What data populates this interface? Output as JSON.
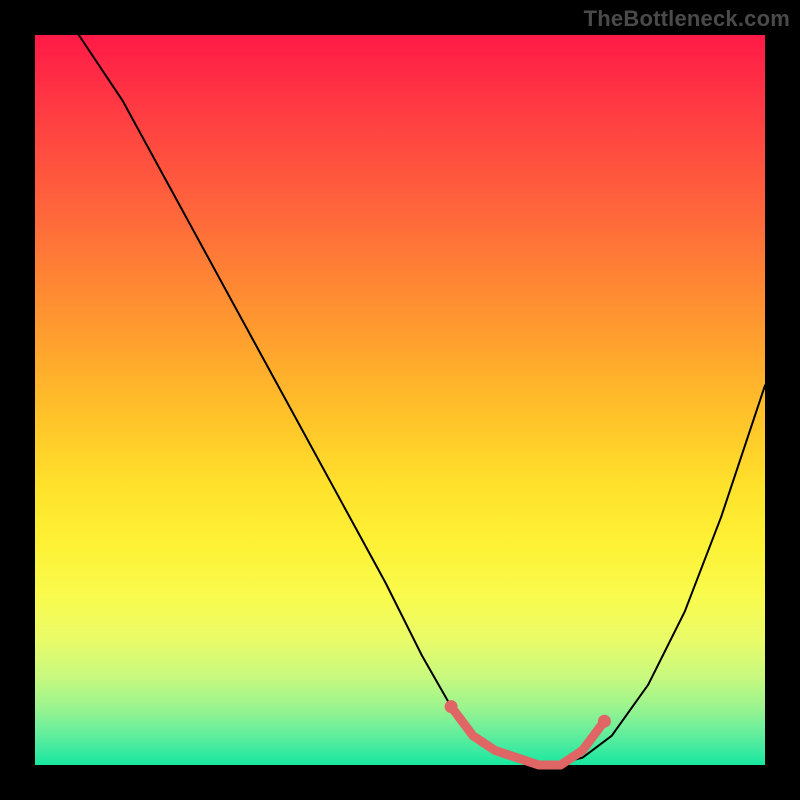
{
  "watermark": "TheBottleneck.com",
  "chart_data": {
    "type": "line",
    "title": "",
    "xlabel": "",
    "ylabel": "",
    "xlim": [
      0,
      100
    ],
    "ylim": [
      0,
      100
    ],
    "grid": false,
    "legend": false,
    "series": [
      {
        "name": "bottleneck-curve",
        "x": [
          0,
          6,
          12,
          18,
          24,
          30,
          36,
          42,
          48,
          53,
          57,
          61,
          65,
          68,
          71,
          75,
          79,
          84,
          89,
          94,
          100
        ],
        "values": [
          106,
          100,
          91,
          80,
          69,
          58,
          47,
          36,
          25,
          15,
          8,
          3,
          1,
          0,
          0,
          1,
          4,
          11,
          21,
          34,
          52
        ]
      }
    ],
    "highlight_range": {
      "name": "optimal-region",
      "x": [
        57,
        60,
        63,
        66,
        69,
        72,
        75,
        78
      ],
      "values": [
        8,
        4,
        2,
        1,
        0,
        0,
        2,
        6
      ]
    },
    "background_gradient": {
      "top_color": "#ff1a47",
      "bottom_color": "#18e7a0",
      "direction": "vertical"
    }
  }
}
